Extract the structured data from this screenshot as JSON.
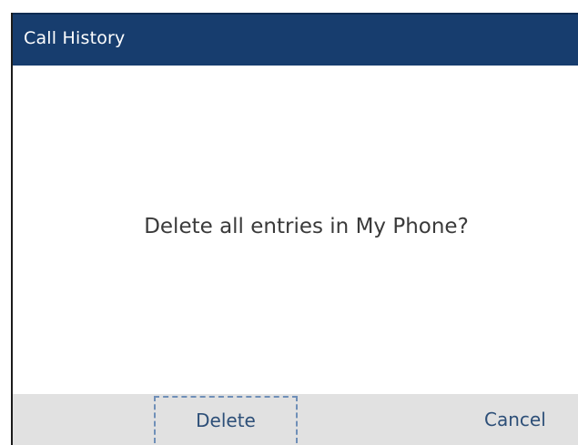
{
  "header": {
    "title": "Call History"
  },
  "dialog": {
    "message": "Delete all entries in My Phone?"
  },
  "softkeys": {
    "delete_label": "Delete",
    "cancel_label": "Cancel"
  },
  "colors": {
    "title_bar": "#173d6e",
    "softkey_bar": "#e1e1e1",
    "softkey_text": "#2d4f78",
    "focus_outline": "#6f8fb8"
  }
}
